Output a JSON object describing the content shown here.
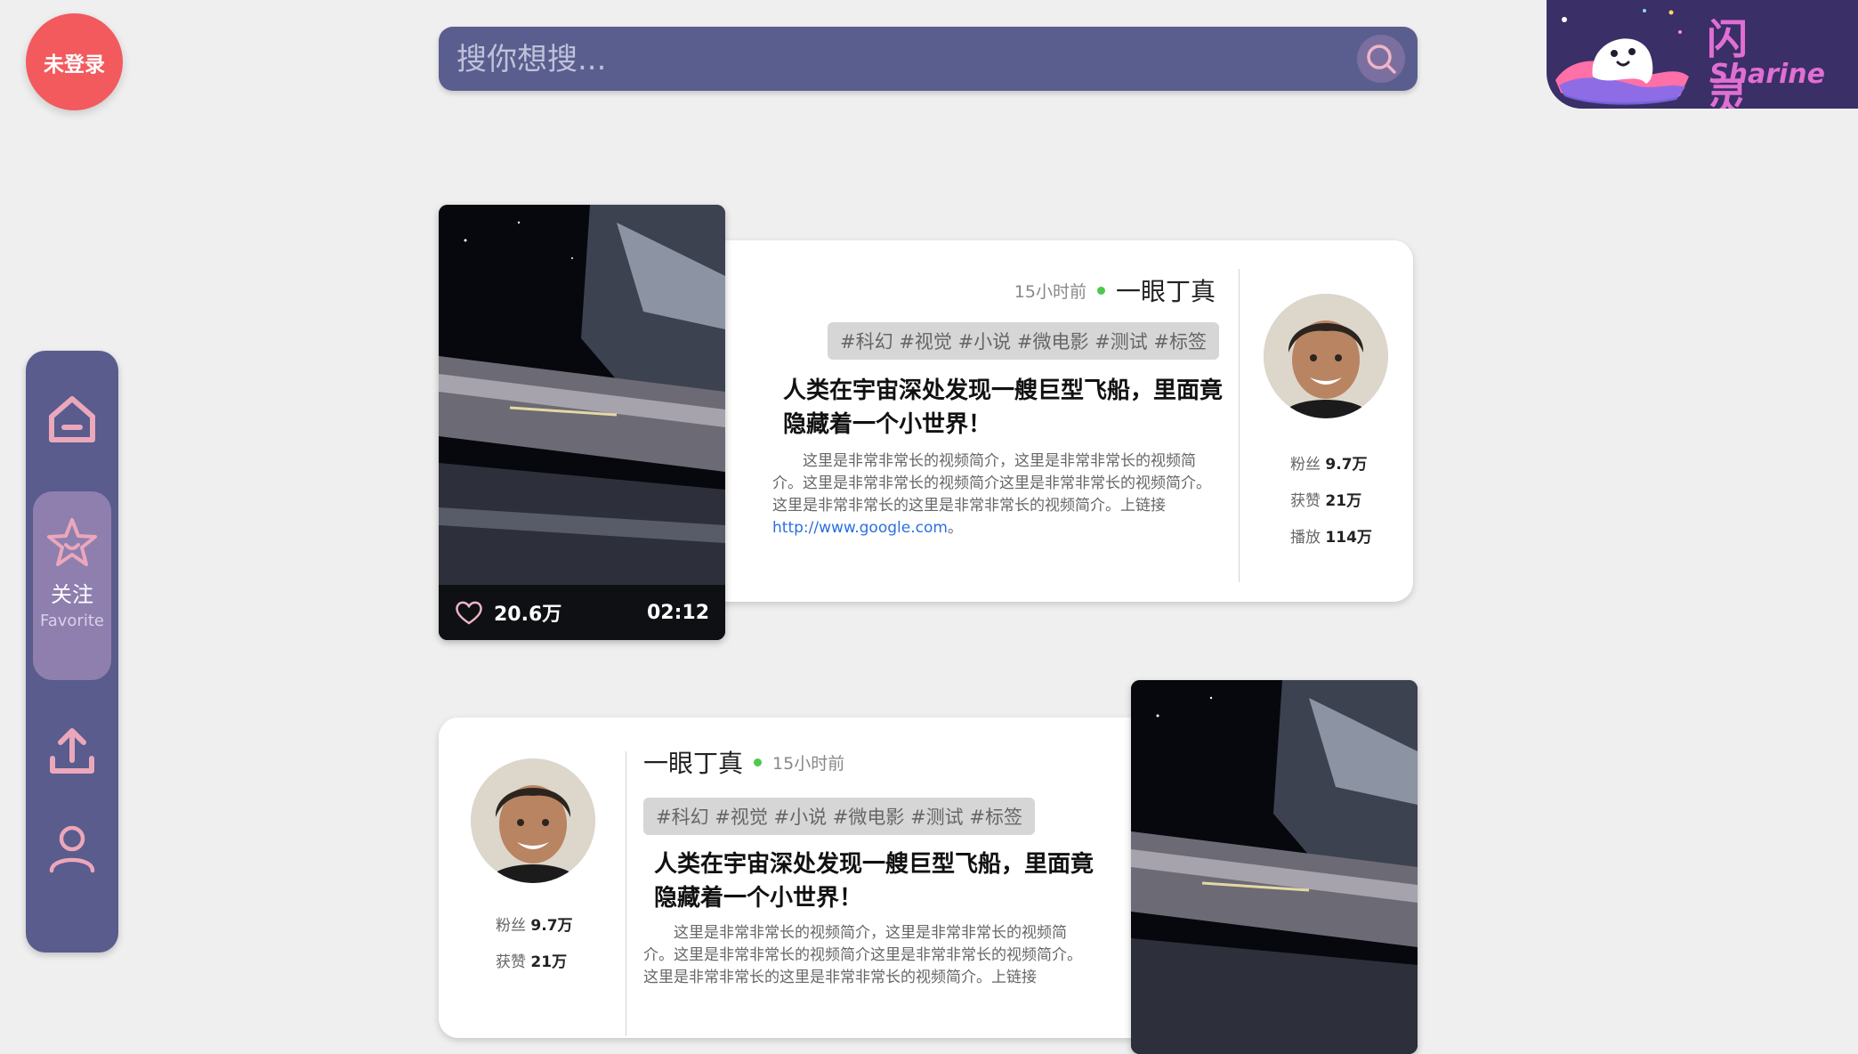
{
  "header": {
    "login_label": "未登录",
    "search_placeholder": "搜你想搜...",
    "logo_cn": "闪 灵",
    "logo_en": "Sharine"
  },
  "sidebar": {
    "active_label_cn": "关注",
    "active_label_en": "Favorite"
  },
  "videos": [
    {
      "likes": "20.6万",
      "duration": "02:12",
      "time": "15小时前",
      "author": "一眼丁真",
      "tags": "#科幻 #视觉 #小说 #微电影 #测试 #标签",
      "title": "人类在宇宙深处发现一艘巨型飞船，里面竟隐藏着一个小世界！",
      "desc": "这里是非常非常长的视频简介，这里是非常非常长的视频简介。这里是非常非常长的视频简介这里是非常非常长的视频简介。这里是非常非常长的这里是非常非常长的视频简介。上链接",
      "link": "http://www.google.com",
      "desc_end": "。",
      "fans_label": "粉丝",
      "fans": "9.7万",
      "likes_label": "获赞",
      "likes_total": "21万",
      "plays_label": "播放",
      "plays": "114万"
    },
    {
      "time": "15小时前",
      "author": "一眼丁真",
      "tags": "#科幻 #视觉 #小说 #微电影 #测试 #标签",
      "title": "人类在宇宙深处发现一艘巨型飞船，里面竟隐藏着一个小世界！",
      "desc": "这里是非常非常长的视频简介，这里是非常非常长的视频简介。这里是非常非常长的视频简介这里是非常非常长的视频简介。这里是非常非常长的这里是非常非常长的视频简介。上链接",
      "fans_label": "粉丝",
      "fans": "9.7万",
      "likes_label": "获赞",
      "likes_total": "21万"
    }
  ],
  "colors": {
    "background": "#efefef",
    "sidebar": "#595c8c",
    "sidebar_active": "#8e7fae",
    "accent_pink": "#e8a6b6",
    "login_red": "#f25a5e",
    "online_dot": "#4dc94d",
    "link": "#2a6fe0"
  },
  "icons": [
    "search-icon",
    "home-icon",
    "star-icon",
    "upload-icon",
    "user-icon",
    "heart-icon"
  ]
}
